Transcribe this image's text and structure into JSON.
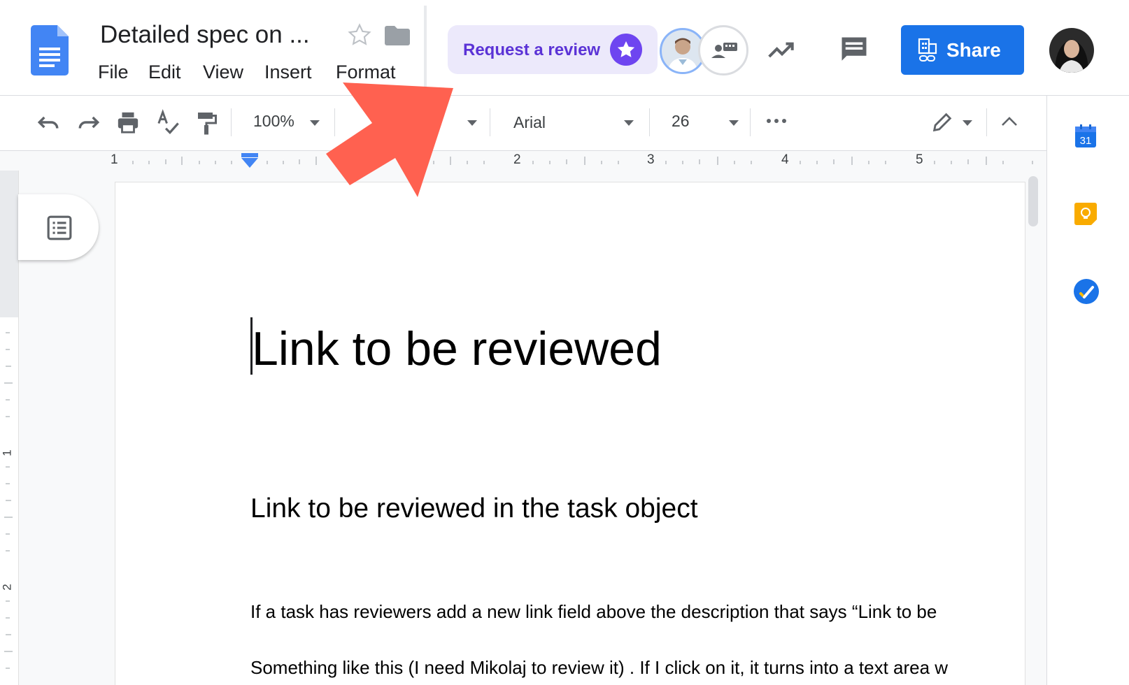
{
  "header": {
    "doc_title": "Detailed spec on ...",
    "menu": [
      "File",
      "Edit",
      "View",
      "Insert",
      "Format"
    ],
    "request_review_label": "Request a review",
    "share_label": "Share"
  },
  "toolbar": {
    "zoom": "100%",
    "font": "Arial",
    "font_size": "26"
  },
  "ruler": {
    "numbers": [
      "1",
      "2",
      "3",
      "4",
      "5"
    ]
  },
  "vertical_ruler": {
    "numbers": [
      "1",
      "2"
    ]
  },
  "document": {
    "title": "Link to be reviewed",
    "subtitle": "Link to be reviewed in the task object",
    "paragraphs": [
      "If a task has reviewers add a new link field above the description that says “Link to be",
      "Something like this (I need Mikolaj to review it) . If I click on it, it turns into a text area w"
    ]
  },
  "colors": {
    "share_blue": "#1a73e8",
    "review_purple": "#6e45f0",
    "arrow_red": "#ff6150",
    "docs_blue": "#4285f4"
  },
  "icons": {
    "app": "docs-icon",
    "star": "star-icon",
    "folder": "folder-icon",
    "activity": "trending-up-icon",
    "comments": "comment-icon",
    "share": "share-building-icon",
    "undo": "undo-icon",
    "redo": "redo-icon",
    "print": "print-icon",
    "spellcheck": "spellcheck-icon",
    "paint_format": "paint-format-icon",
    "more": "more-horizontal-icon",
    "edit_mode": "pencil-icon",
    "collapse": "chevron-up-icon",
    "outline": "outline-list-icon",
    "calendar": "calendar-icon",
    "keep": "keep-icon",
    "tasks": "tasks-icon"
  }
}
